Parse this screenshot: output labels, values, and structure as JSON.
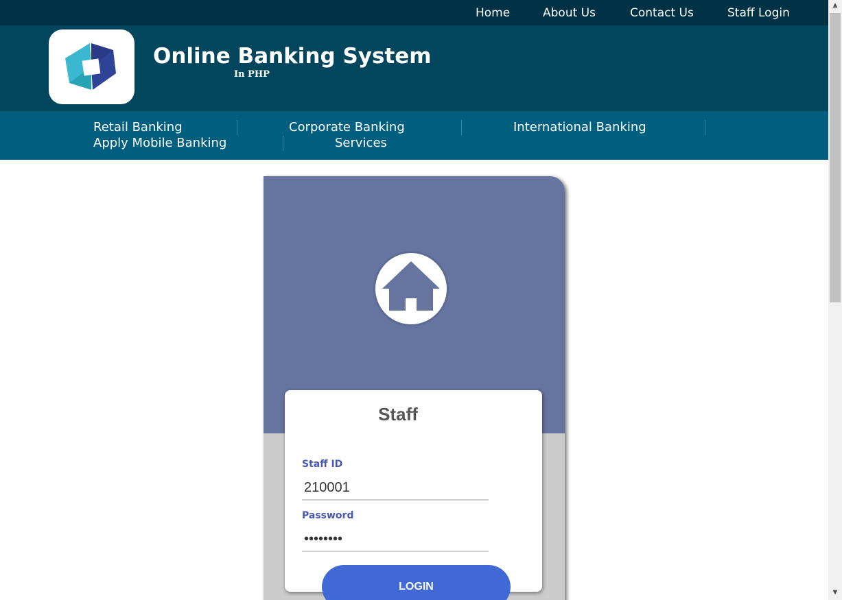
{
  "top_nav": {
    "home": "Home",
    "about": "About Us",
    "contact": "Contact Us",
    "staff_login": "Staff Login"
  },
  "header": {
    "title": "Online Banking System",
    "subtitle": "In PHP",
    "logo_icon": "bank-logo-icon"
  },
  "sub_nav": {
    "retail": "Retail Banking",
    "corporate": "Corporate Banking",
    "international": "International Banking",
    "mobile": "Apply Mobile Banking",
    "services": "Services"
  },
  "login_card": {
    "icon": "home-icon",
    "title": "Staff",
    "staff_id_label": "Staff ID",
    "staff_id_value": "210001",
    "password_label": "Password",
    "password_value": "••••••••",
    "login_button": "LOGIN"
  },
  "colors": {
    "top_bar": "#003246",
    "header": "#01465c",
    "sub_nav": "#005f7f",
    "card_top": "#65759f",
    "accent": "#4169d6",
    "label": "#4757b8"
  }
}
